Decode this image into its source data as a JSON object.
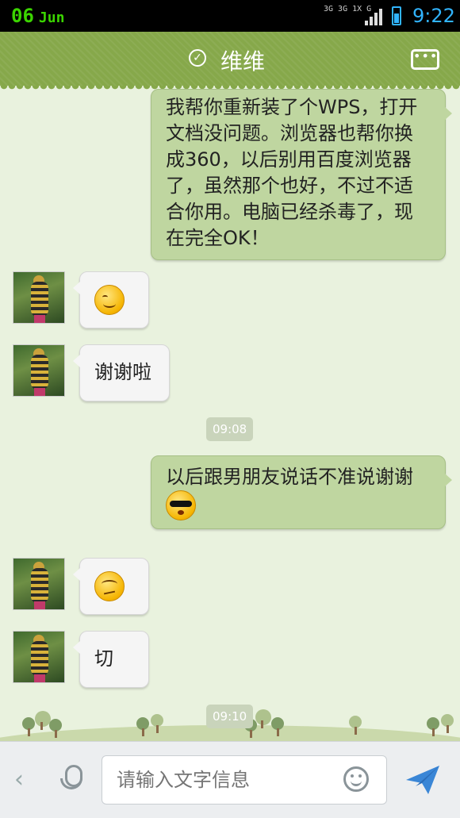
{
  "status_bar": {
    "date_day": "06",
    "date_month": "Jun",
    "network_line1": "3G 3G 1X G",
    "time": "9:22"
  },
  "header": {
    "title": "维维",
    "more_icon": "more-dots-icon",
    "verified_icon": "check-circle-icon"
  },
  "messages": [
    {
      "direction": "out",
      "text": "我帮你重新装了个WPS，打开文档没问题。浏览器也帮你换成360，以后别用百度浏览器了，虽然那个也好，不过不适合你用。电脑已经杀毒了，现在完全OK！"
    },
    {
      "direction": "in",
      "emoji": "smile-emoji"
    },
    {
      "direction": "in",
      "text": "谢谢啦"
    },
    {
      "timestamp": "09:08"
    },
    {
      "direction": "out",
      "text": "以后跟男朋友说话不准说谢谢",
      "emoji": "cool-emoji"
    },
    {
      "direction": "in",
      "emoji": "doubt-emoji"
    },
    {
      "direction": "in",
      "text": "切"
    },
    {
      "timestamp": "09:10"
    }
  ],
  "input_bar": {
    "placeholder": "请输入文字信息"
  },
  "colors": {
    "header": "#86a84a",
    "outgoing_bubble": "#bfd6a0",
    "incoming_bubble": "#f5f5f5",
    "background": "#e9f2de",
    "accent": "#31b4ff"
  }
}
